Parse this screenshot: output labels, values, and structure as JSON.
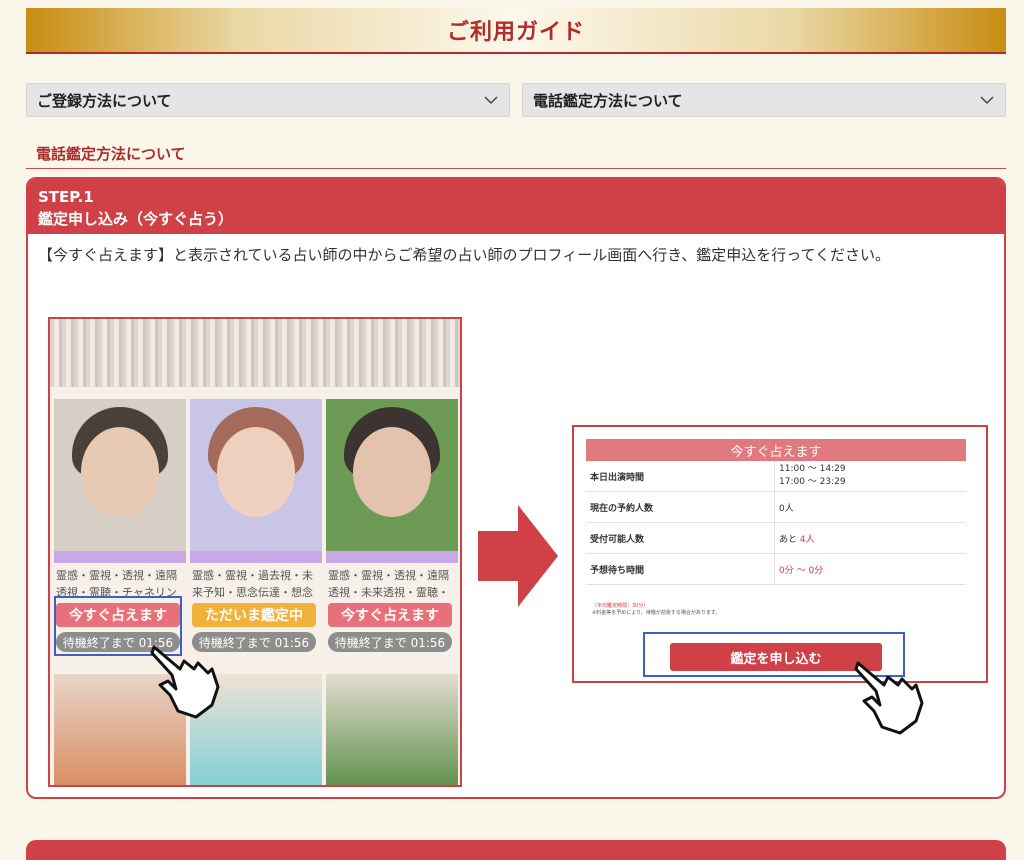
{
  "banner": {
    "title": "ご利用ガイド"
  },
  "selects": [
    {
      "label": "ご登録方法について"
    },
    {
      "label": "電話鑑定方法について"
    }
  ],
  "section": {
    "heading": "電話鑑定方法について"
  },
  "step": {
    "number": "STEP.1",
    "title": "鑑定申し込み（今すぐ占う）",
    "description": "【今すぐ占えます】と表示されている占い師の中からご希望の占い師のプロフィール画面へ行き、鑑定申込を行ってください。"
  },
  "left_image": {
    "cards": [
      {
        "tags1": "霊感・霊視・透視・遠隔",
        "tags2": "透視・霊聴・チャネリン",
        "button": "今すぐ占えます",
        "wait": "待機終了まで 01:56"
      },
      {
        "tags1": "霊感・霊視・過去視・未",
        "tags2": "来予知・思念伝達・想念",
        "button": "ただいま鑑定中",
        "wait": "待機終了まで 01:56"
      },
      {
        "tags1": "霊感・霊視・透視・遠隔",
        "tags2": "透視・未来透視・霊聴・",
        "button": "今すぐ占えます",
        "wait": "待機終了まで 01:56"
      }
    ]
  },
  "right_image": {
    "header": "今すぐ占えます",
    "rows": [
      {
        "key": "本日出演時間",
        "value": "11:00 〜 14:29",
        "value2": "17:00 〜 23:29"
      },
      {
        "key": "現在の予約人数",
        "value": "0人"
      },
      {
        "key": "受付可能人数",
        "value_prefix": "あと ",
        "value_red": "4人"
      },
      {
        "key": "予想待ち時間",
        "value_red": "0分 〜 0分"
      }
    ],
    "note1": "（平均鑑定時間：30分）",
    "note2": "※料金等を予めにより、待機が前後する場合があります。",
    "button": "鑑定を申し込む"
  },
  "colors": {
    "accent": "#cf4146",
    "gold": "#c88d12",
    "highlight": "#3a62c4",
    "background": "#fbf6ea"
  }
}
